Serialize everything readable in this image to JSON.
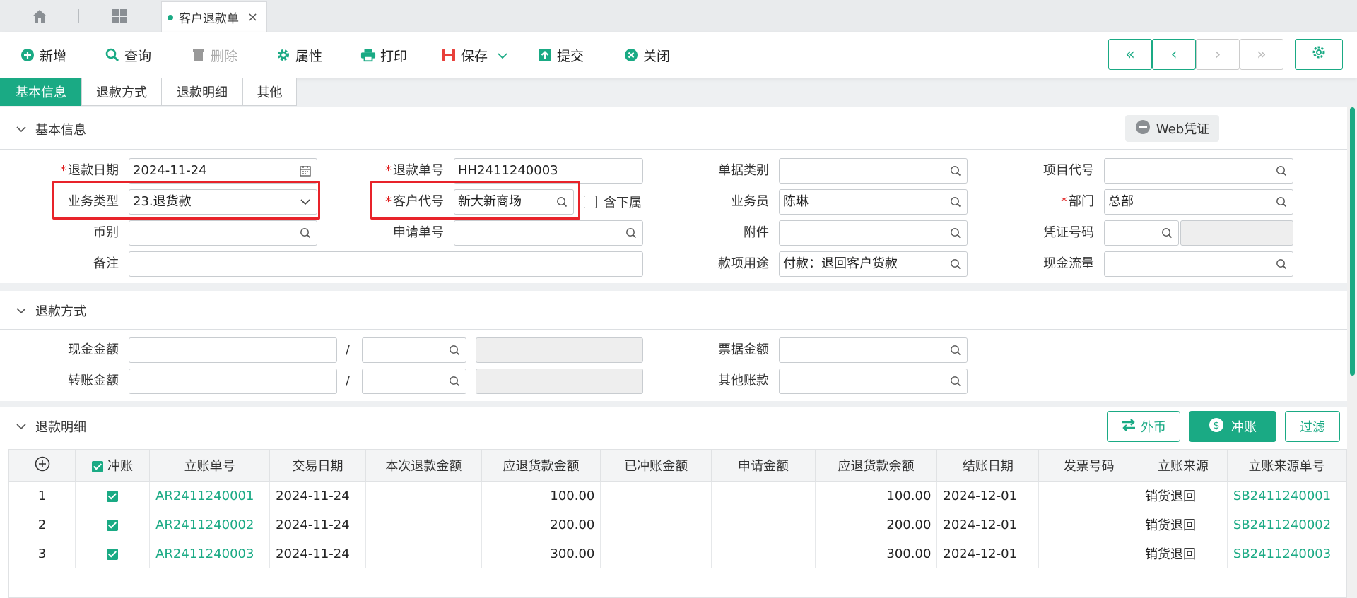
{
  "tabbar": {
    "doc_tab": "客户退款单",
    "close": "×"
  },
  "toolbar": {
    "add": "新增",
    "query": "查询",
    "delete": "删除",
    "properties": "属性",
    "print": "打印",
    "save": "保存",
    "submit": "提交",
    "close": "关闭",
    "nav_first": "«",
    "nav_prev": "‹",
    "nav_next": "›",
    "nav_last": "»"
  },
  "section_tabs": [
    "基本信息",
    "退款方式",
    "退款明细",
    "其他"
  ],
  "basic": {
    "title": "基本信息",
    "web_voucher": "Web凭证",
    "refund_date_label": "退款日期",
    "refund_date": "2024-11-24",
    "refund_no_label": "退款单号",
    "refund_no": "HH2411240003",
    "doc_type_label": "单据类别",
    "doc_type": "",
    "project_code_label": "项目代号",
    "project_code": "",
    "biz_type_label": "业务类型",
    "biz_type": "23.退货款",
    "customer_code_label": "客户代号",
    "customer_code": "新大新商场",
    "include_sub_label": "含下属",
    "salesman_label": "业务员",
    "salesman": "陈琳",
    "dept_label": "部门",
    "dept": "总部",
    "currency_label": "币别",
    "currency": "",
    "apply_no_label": "申请单号",
    "apply_no": "",
    "attachment_label": "附件",
    "attachment": "",
    "voucher_no_label": "凭证号码",
    "voucher_no": "",
    "remark_label": "备注",
    "remark": "",
    "purpose_label": "款项用途",
    "purpose": "付款：退回客户货款",
    "cashflow_label": "现金流量",
    "cashflow": ""
  },
  "method": {
    "title": "退款方式",
    "cash_label": "现金金额",
    "transfer_label": "转账金额",
    "slash": "/",
    "bill_label": "票据金额",
    "other_label": "其他账款"
  },
  "detail": {
    "title": "退款明细",
    "btn_fx": "外币",
    "btn_offset": "冲账",
    "btn_filter": "过滤",
    "columns": [
      "冲账",
      "立账单号",
      "交易日期",
      "本次退款金额",
      "应退货款金额",
      "已冲账金额",
      "申请金额",
      "应退货款余额",
      "结账日期",
      "发票号码",
      "立账来源",
      "立账来源单号"
    ],
    "rows": [
      {
        "idx": "1",
        "ar_no": "AR2411240001",
        "date": "2024-11-24",
        "this_amt": "",
        "due_amt": "100.00",
        "offset_amt": "",
        "apply_amt": "",
        "balance": "100.00",
        "close_date": "2024-12-01",
        "invoice": "",
        "source": "销货退回",
        "source_no": "SB2411240001"
      },
      {
        "idx": "2",
        "ar_no": "AR2411240002",
        "date": "2024-11-24",
        "this_amt": "",
        "due_amt": "200.00",
        "offset_amt": "",
        "apply_amt": "",
        "balance": "200.00",
        "close_date": "2024-12-01",
        "invoice": "",
        "source": "销货退回",
        "source_no": "SB2411240002"
      },
      {
        "idx": "3",
        "ar_no": "AR2411240003",
        "date": "2024-11-24",
        "this_amt": "",
        "due_amt": "300.00",
        "offset_amt": "",
        "apply_amt": "",
        "balance": "300.00",
        "close_date": "2024-12-01",
        "invoice": "",
        "source": "销货退回",
        "source_no": "SB2411240003"
      }
    ]
  },
  "colors": {
    "accent": "#1aaa84",
    "required": "#e02020",
    "highlight": "#e8232a"
  }
}
